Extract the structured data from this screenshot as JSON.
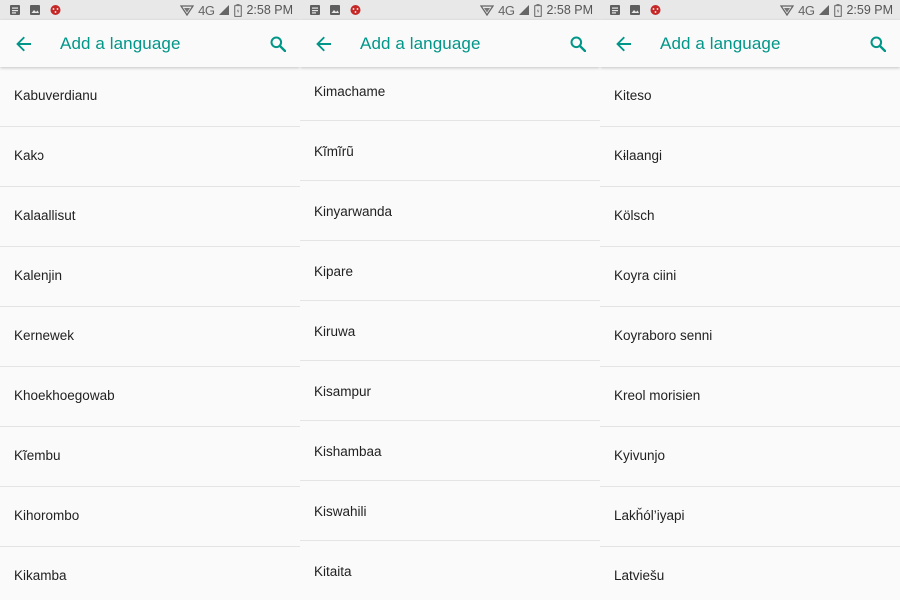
{
  "app": {
    "accent_color": "#009688",
    "title": "Add a language"
  },
  "screens": [
    {
      "status": {
        "network": "4G",
        "time": "2:58 PM"
      },
      "title": "Add a language",
      "languages": [
        "Kabuverdianu",
        "Kakɔ",
        "Kalaallisut",
        "Kalenjin",
        "Kernewek",
        "Khoekhoegowab",
        "Kĩembu",
        "Kihorombo",
        "Kikamba"
      ]
    },
    {
      "status": {
        "network": "4G",
        "time": "2:58 PM"
      },
      "title": "Add a language",
      "languages": [
        "Kimachame",
        "Kĩmĩrũ",
        "Kinyarwanda",
        "Kipare",
        "Kiruwa",
        "Kisampur",
        "Kishambaa",
        "Kiswahili",
        "Kitaita"
      ]
    },
    {
      "status": {
        "network": "4G",
        "time": "2:59 PM"
      },
      "title": "Add a language",
      "languages": [
        "Kiteso",
        "Kɨlaangi",
        "Kölsch",
        "Koyra ciini",
        "Koyraboro senni",
        "Kreol morisien",
        "Kyivunjo",
        "Lakȟól’iyapi",
        "Latviešu"
      ]
    }
  ],
  "icons": {
    "back": "arrow-back-icon",
    "search": "search-icon",
    "notification_1": "message-icon",
    "notification_2": "image-icon",
    "notification_3": "bug-icon",
    "signal": "signal-icon",
    "battery": "battery-icon"
  }
}
